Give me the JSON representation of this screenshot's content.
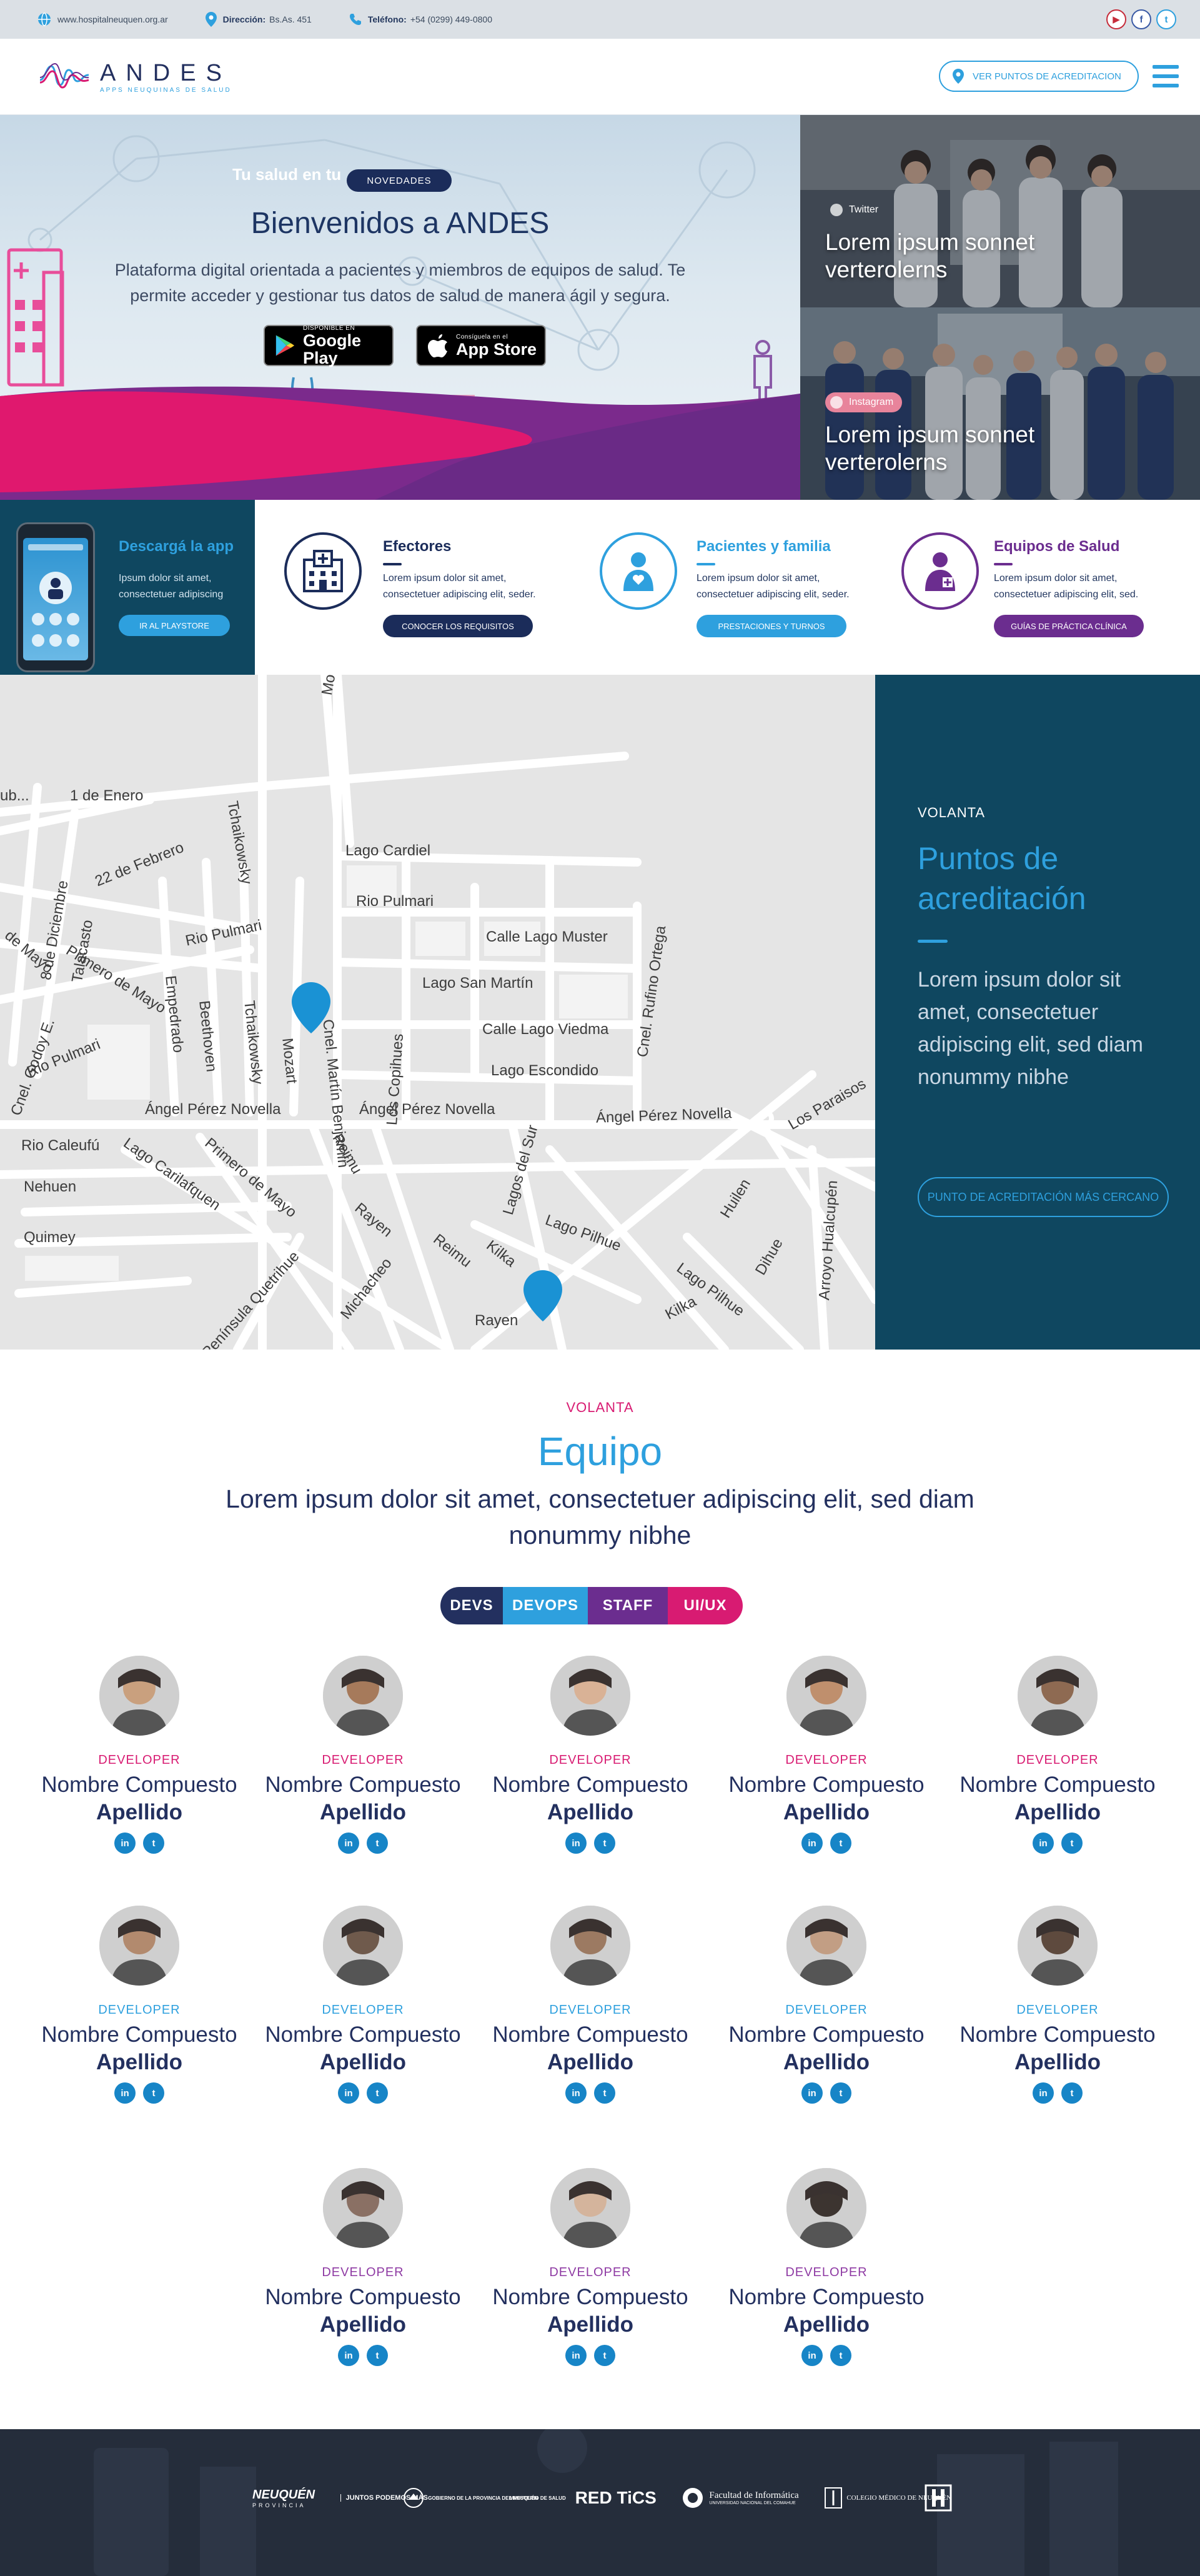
{
  "topbar": {
    "website": "www.hospitalneuquen.org.ar",
    "address_label": "Dirección:",
    "address": "Bs.As. 451",
    "phone_label": "Teléfono:",
    "phone": "+54 (0299) 449-0800"
  },
  "header": {
    "logo_title": "ANDES",
    "logo_subtitle": "APPS NEUQUINAS DE SALUD",
    "accreditation_button": "VER PUNTOS DE ACREDITACION"
  },
  "hero": {
    "tagline": "Tu salud en tu",
    "badge": "NOVEDADES",
    "title": "Bienvenidos a ANDES",
    "description": "Plataforma digital orientada a pacientes y miembros de equipos de salud. Te permite acceder y gestionar tus datos de salud de manera ágil y segura.",
    "google_play_small": "DISPONIBLE EN",
    "google_play_large": "Google Play",
    "app_store_small": "Consíguela en el",
    "app_store_large": "App Store"
  },
  "social_cards": [
    {
      "network": "Twitter",
      "text": "Lorem ipsum sonnet verterolerns",
      "color": "#2ea0de"
    },
    {
      "network": "Instagram",
      "text": "Lorem ipsum sonnet verterolerns",
      "color": "#e8849b"
    }
  ],
  "features": {
    "app": {
      "title": "Descargá la app",
      "description": "Ipsum dolor sit amet, consectetuer adipiscing",
      "button": "IR AL PLAYSTORE"
    },
    "items": [
      {
        "title": "Efectores",
        "description": "Lorem ipsum dolor sit amet, consectetuer adipiscing elit, seder.",
        "button": "CONOCER LOS REQUISITOS",
        "color": "#1b2c5a"
      },
      {
        "title": "Pacientes y familia",
        "description": "Lorem ipsum dolor sit amet, consectetuer adipiscing elit, seder.",
        "button": "PRESTACIONES Y TURNOS",
        "color": "#2ea0de"
      },
      {
        "title": "Equipos de Salud",
        "description": "Lorem ipsum dolor sit amet, consectetuer adipiscing elit, sed.",
        "button": "GUÍAS DE PRÁCTICA CLÍNICA",
        "color": "#6b2d8f"
      }
    ]
  },
  "map": {
    "streets": [
      "Mortán",
      "1 de Enero",
      "ub...",
      "22 de Febrero",
      "Tchaikowsky",
      "Lago Cardiel",
      "Rio Pulmari",
      "Calle Lago Muster",
      "Cnel. Rufino Ortega",
      "Lago San Martín",
      "Calle Lago Viedma",
      "Lago Escondido",
      "Rio Pulmari",
      "Primero de Mayo",
      "Empedrado",
      "Beethoven",
      "Tchaikowsky",
      "Mozart",
      "Cnel. Martín Benjamín",
      "Los Copihues",
      "Rio Pulmari",
      "Cnel. Godoy E.",
      "de Mayo",
      "8 de Diciembre",
      "Talacasto",
      "Ángel Pérez Novella",
      "Ángel Pérez Novella",
      "Ángel Pérez Novella",
      "Los Paraisos",
      "Rio Caleufú",
      "Lago Carilafquen",
      "Primero de Mayo",
      "Reimu",
      "Nehuen",
      "Quimey",
      "Rayen",
      "Michacheo",
      "Reimu",
      "Península Quetrihue",
      "Lagos del Sur",
      "Lago Pilhue",
      "Kilka",
      "Huilen",
      "Arroyo Hualcupén",
      "Dihue",
      "Lago Pilhue",
      "Kilka",
      "Rayen"
    ],
    "panel_kicker": "VOLANTA",
    "panel_title": "Puntos de acreditación",
    "panel_description": "Lorem ipsum dolor sit amet, consectetuer adipiscing elit, sed diam nonummy nibhe",
    "panel_button": "PUNTO DE ACREDITACIÓN MÁS CERCANO"
  },
  "team": {
    "kicker": "VOLANTA",
    "title": "Equipo",
    "subtitle": "Lorem ipsum dolor sit amet, consectetuer adipiscing elit, sed diam nonummy nibhe",
    "tabs": [
      {
        "label": "DEVS",
        "color": "#23305f"
      },
      {
        "label": "DEVOPS",
        "color": "#2ea0de"
      },
      {
        "label": "STAFF",
        "color": "#6b2d8f"
      },
      {
        "label": "UI/UX",
        "color": "#d81b72"
      }
    ],
    "members": [
      {
        "role": "DEVELOPER",
        "first": "Nombre Compuesto",
        "last": "Apellido",
        "role_color": "#d81b72"
      },
      {
        "role": "DEVELOPER",
        "first": "Nombre Compuesto",
        "last": "Apellido",
        "role_color": "#d81b72"
      },
      {
        "role": "DEVELOPER",
        "first": "Nombre Compuesto",
        "last": "Apellido",
        "role_color": "#d81b72"
      },
      {
        "role": "DEVELOPER",
        "first": "Nombre Compuesto",
        "last": "Apellido",
        "role_color": "#d81b72"
      },
      {
        "role": "DEVELOPER",
        "first": "Nombre Compuesto",
        "last": "Apellido",
        "role_color": "#d81b72"
      },
      {
        "role": "DEVELOPER",
        "first": "Nombre Compuesto",
        "last": "Apellido",
        "role_color": "#2ea0de"
      },
      {
        "role": "DEVELOPER",
        "first": "Nombre Compuesto",
        "last": "Apellido",
        "role_color": "#2ea0de"
      },
      {
        "role": "DEVELOPER",
        "first": "Nombre Compuesto",
        "last": "Apellido",
        "role_color": "#2ea0de"
      },
      {
        "role": "DEVELOPER",
        "first": "Nombre Compuesto",
        "last": "Apellido",
        "role_color": "#2ea0de"
      },
      {
        "role": "DEVELOPER",
        "first": "Nombre Compuesto",
        "last": "Apellido",
        "role_color": "#2ea0de"
      },
      {
        "role": "DEVELOPER",
        "first": "Nombre Compuesto",
        "last": "Apellido",
        "role_color": "#8e3aa3"
      },
      {
        "role": "DEVELOPER",
        "first": "Nombre Compuesto",
        "last": "Apellido",
        "role_color": "#8e3aa3"
      },
      {
        "role": "DEVELOPER",
        "first": "Nombre Compuesto",
        "last": "Apellido",
        "role_color": "#8e3aa3"
      }
    ]
  },
  "footer": {
    "logos": [
      "NEUQUÉN",
      "PROVINCIA",
      "JUNTOS PODEMOS MÁS",
      "GOBIERNO DE LA PROVINCIA DEL NEUQUÉN",
      "MINISTERIO DE SALUD",
      "RED TiCS",
      "Facultad de Informática",
      "UNIVERSIDAD NACIONAL DEL COMAHUE",
      "COLEGIO MÉDICO DE NEUQUÉN"
    ]
  }
}
